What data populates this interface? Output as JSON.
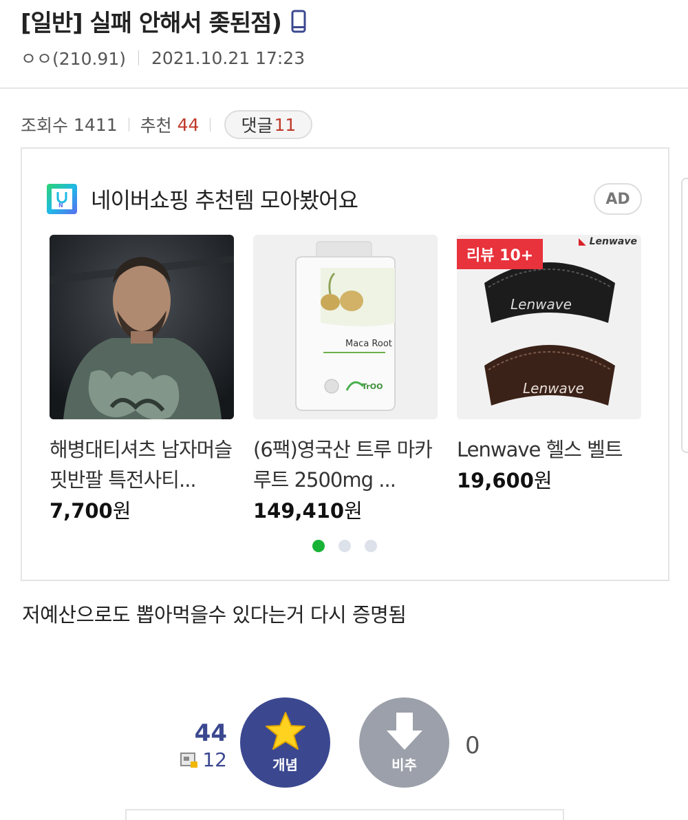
{
  "post": {
    "title": "[일반] 실패 안해서 좆된점)",
    "author": "ㅇㅇ(210.91)",
    "datetime": "2021.10.21 17:23"
  },
  "stats": {
    "views_label": "조회수",
    "views": "1411",
    "recommend_label": "추천",
    "recommend": "44",
    "comments_label": "댓글",
    "comments": "11"
  },
  "ad": {
    "title": "네이버쇼핑 추천템 모아봤어요",
    "badge": "AD",
    "products": [
      {
        "name": "해병대티셔츠 남자머슬핏반팔 특전사티...",
        "price": "7,700",
        "currency": "원"
      },
      {
        "name": "(6팩)영국산 트루 마카루트 2500mg ...",
        "price": "149,410",
        "currency": "원",
        "image_text": "Maca Root",
        "brand_text": "TrOO"
      },
      {
        "name": "Lenwave 헬스 벨트",
        "price": "19,600",
        "currency": "원",
        "badge": "리뷰 10+",
        "brand": "Lenwave"
      }
    ],
    "pagination": {
      "total": 3,
      "active": 0
    }
  },
  "body_text": "저예산으로도 뽑아먹을수 있다는거 다시 증명됨",
  "vote": {
    "up_count": "44",
    "fixed_count": "12",
    "up_label": "개념",
    "down_label": "비추",
    "down_count": "0"
  },
  "colors": {
    "accent_blue": "#3b4890",
    "down_gray": "#9ba0aa",
    "red_number": "#c0392b",
    "naver_green": "#18b336"
  }
}
